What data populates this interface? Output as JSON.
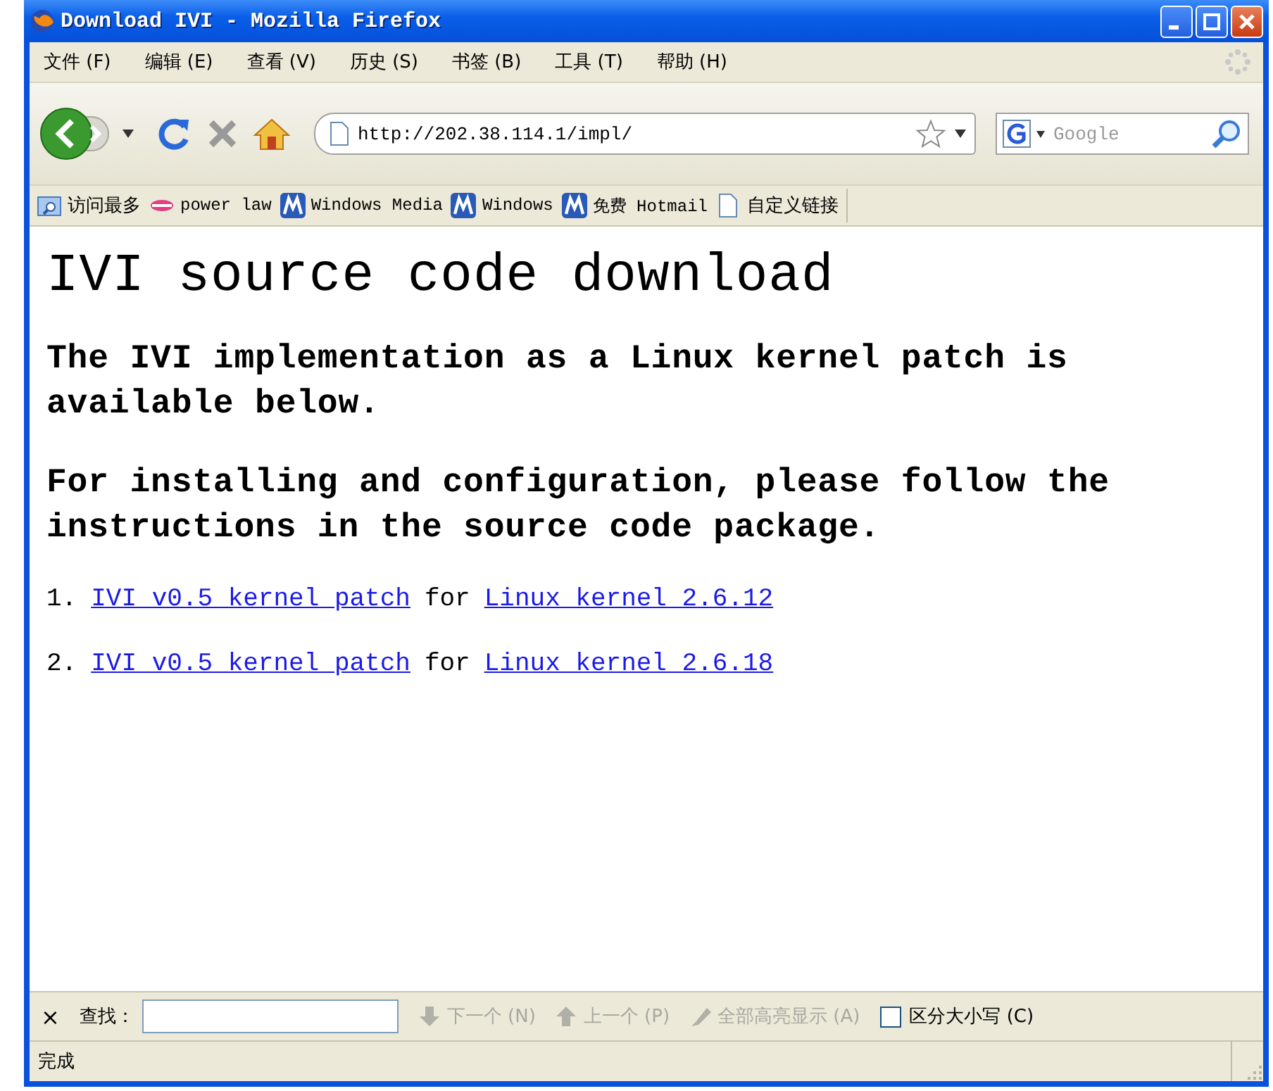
{
  "window": {
    "title": "Download IVI - Mozilla Firefox"
  },
  "menu": [
    {
      "label": "文件 (F)"
    },
    {
      "label": "编辑 (E)"
    },
    {
      "label": "查看 (V)"
    },
    {
      "label": "历史 (S)"
    },
    {
      "label": "书签 (B)"
    },
    {
      "label": "工具 (T)"
    },
    {
      "label": "帮助 (H)"
    }
  ],
  "toolbar": {
    "url": "http://202.38.114.1/impl/",
    "search": {
      "placeholder": "Google"
    }
  },
  "bookmarks": [
    {
      "label": "访问最多",
      "kind": "smart"
    },
    {
      "label": "power law",
      "kind": "site"
    },
    {
      "label": "Windows Media",
      "kind": "msn"
    },
    {
      "label": "Windows",
      "kind": "msn"
    },
    {
      "label": "免费 Hotmail",
      "kind": "msn"
    },
    {
      "label": "自定义链接",
      "kind": "page"
    }
  ],
  "page": {
    "heading": "IVI source code download",
    "paragraphs": [
      "The IVI implementation as a Linux kernel patch is available below.",
      "For installing and configuration, please follow the instructions in the source code package."
    ],
    "downloads": [
      {
        "number": "1.",
        "link": "IVI v0.5 kernel patch",
        "joiner": "for",
        "target": "Linux kernel 2.6.12"
      },
      {
        "number": "2.",
        "link": "IVI v0.5 kernel patch",
        "joiner": "for",
        "target": "Linux kernel 2.6.18"
      }
    ]
  },
  "find_bar": {
    "close": "×",
    "label": "查找：",
    "buttons": [
      {
        "label": "下一个 (N)",
        "kind": "next",
        "disabled": true
      },
      {
        "label": "上一个 (P)",
        "kind": "previous",
        "disabled": true
      },
      {
        "label": "全部高亮显示 (A)",
        "kind": "highlight",
        "disabled": true
      }
    ],
    "match_case": {
      "label": "区分大小写 (C)",
      "checked": false
    }
  },
  "status_bar": {
    "text": "完成"
  }
}
